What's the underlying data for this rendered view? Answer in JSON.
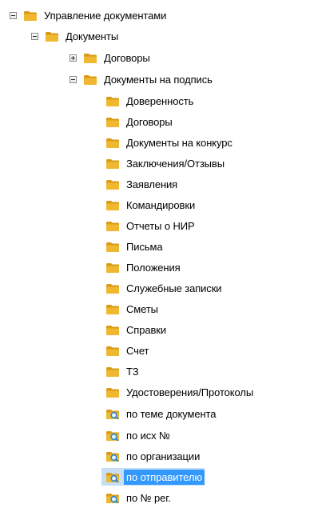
{
  "tree": {
    "root": {
      "label": "Управление документами",
      "expanded": true
    },
    "documents": {
      "label": "Документы",
      "expanded": true
    },
    "contracts": {
      "label": "Договоры",
      "expanded": false
    },
    "to_sign": {
      "label": "Документы на подпись",
      "expanded": true
    },
    "to_sign_children": [
      "Доверенность",
      "Договоры",
      "Документы на конкурс",
      "Заключения/Отзывы",
      "Заявления",
      "Командировки",
      "Отчеты о НИР",
      "Письма",
      "Положения",
      "Служебные записки",
      "Сметы",
      "Справки",
      "Счет",
      "ТЗ",
      "Удостоверения/Протоколы"
    ],
    "search_views": [
      {
        "label": "по  теме  документа",
        "selected": false
      },
      {
        "label": "по исх №",
        "selected": false
      },
      {
        "label": "по организации",
        "selected": false
      },
      {
        "label": "по отправителю",
        "selected": true
      },
      {
        "label": "по № рег.",
        "selected": false
      }
    ]
  },
  "icons": {
    "folder": "folder-icon",
    "folder_search": "folder-search-icon",
    "expand": "expand-plus-icon",
    "collapse": "collapse-minus-icon"
  },
  "colors": {
    "folder": "#f0b830",
    "folder_dark": "#d89a18",
    "search_lens": "#2a88d8",
    "selection": "#3399ff"
  }
}
